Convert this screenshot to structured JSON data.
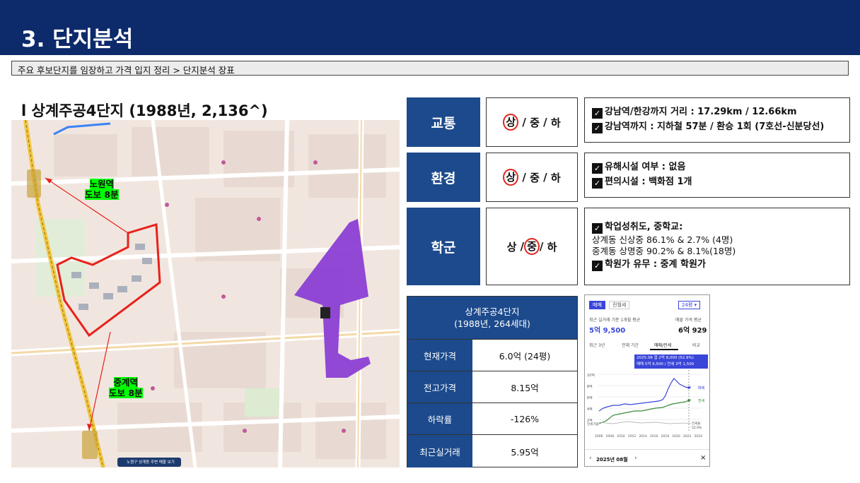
{
  "header": {
    "title": "3. 단지분석"
  },
  "breadcrumb": "주요 후보단지를 임장하고 가격 입지 정리 > 단지분석 장표",
  "complex": {
    "title": "l 상계주공4단지 (1988년, 2,136^)"
  },
  "map": {
    "stations": [
      {
        "name": "노원역",
        "walk": "도보 8분"
      },
      {
        "name": "중계역",
        "walk": "도보 8분"
      }
    ],
    "footer_button": "노원구 상계동 주변 매물 보기"
  },
  "criteria": [
    {
      "category": "교통",
      "grades": [
        "상",
        "중",
        "하"
      ],
      "selected": "상",
      "details": [
        {
          "checked": true,
          "text": "강남역/한강까지 거리 : 17.29km / 12.66km"
        },
        {
          "checked": true,
          "text": "강남역까지 : 지하철 57분 / 환승 1회 (7호선-신분당선)"
        }
      ]
    },
    {
      "category": "환경",
      "grades": [
        "상",
        "중",
        "하"
      ],
      "selected": "상",
      "details": [
        {
          "checked": true,
          "text": "유해시설 여부 : 없음"
        },
        {
          "checked": true,
          "text": "편의시설 : 백화점 1개"
        }
      ]
    },
    {
      "category": "학군",
      "grades": [
        "상",
        "중",
        "하"
      ],
      "selected": "중",
      "details": [
        {
          "checked": true,
          "text": "학업성취도, 중학교:"
        },
        {
          "checked": false,
          "text": "상계동 신상중 86.1% & 2.7% (4명)"
        },
        {
          "checked": false,
          "text": "중계동 상명중 90.2% & 8.1%(18명)"
        },
        {
          "checked": true,
          "text": "학원가 유무 : 중계 학원가"
        }
      ]
    }
  ],
  "price_table": {
    "header_line1": "상계주공4단지",
    "header_line2": "(1988년, 264세대)",
    "rows": [
      {
        "label": "현재가격",
        "value": "6.0억 (24평)"
      },
      {
        "label": "전고가격",
        "value": "8.15억"
      },
      {
        "label": "하락률",
        "value": "-126%"
      },
      {
        "label": "최근실거래",
        "value": "5.95억"
      }
    ]
  },
  "app_screenshot": {
    "tabs": [
      "매매",
      "전월세"
    ],
    "area_select": "24평",
    "avg_label": "최근 실거래 기준 1개월 평균",
    "avg_value": "5억 9,500",
    "ask_label": "매물 가격 평균",
    "ask_value": "6억 929",
    "range_tabs": [
      "최근 3년",
      "전체 기간",
      "매매/전세",
      "비교"
    ],
    "tooltip_line1": "2025.08 갭 2억 8,000 (52.9%)",
    "tooltip_line2": "매매 5억 9,500 / 전세 3억 1,500",
    "y_ticks": [
      "10억",
      "8억",
      "6억",
      "4억",
      "2억",
      "전세가율"
    ],
    "series_labels": [
      "매매",
      "전세",
      "전세율 52.9%"
    ],
    "x_ticks": [
      "2006",
      "2008",
      "2010",
      "2012",
      "2014",
      "2016",
      "2018",
      "2020",
      "2022",
      "2024"
    ],
    "month_nav": "2025년 08월",
    "close": "×",
    "colors": {
      "sale": "#3a46d8",
      "lease": "#3a8a3a"
    }
  },
  "colors": {
    "header": "#0d2a6a",
    "category": "#1c4a8c",
    "circle": "#e0271e",
    "highlight": "#00ff00",
    "boundary": "#e8211b",
    "school_zone": "#8b3fd4"
  }
}
